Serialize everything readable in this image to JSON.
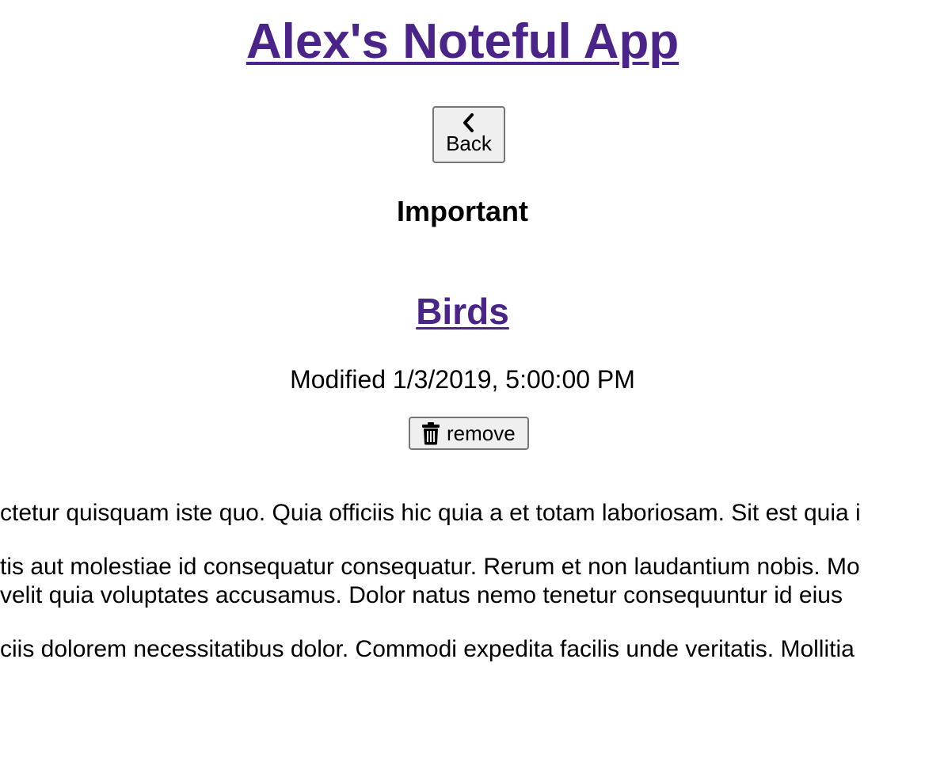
{
  "app": {
    "title": "Alex's Noteful App"
  },
  "sidebar": {
    "back_label": "Back",
    "back_icon": "chevron-left-icon",
    "folder_name": "Important"
  },
  "note": {
    "title": "Birds",
    "modified": "Modified 1/3/2019, 5:00:00 PM",
    "remove_label": "remove",
    "remove_icon": "trash-icon",
    "content_lines": [
      "ctetur quisquam iste quo. Quia officiis hic quia a et totam laboriosam. Sit est quia i",
      "tis aut molestiae id consequatur consequatur. Rerum et non laudantium nobis. Mo",
      " velit quia voluptates accusamus. Dolor natus nemo tenetur consequuntur id eius",
      "ciis dolorem necessitatibus dolor. Commodi expedita facilis unde veritatis. Mollitia"
    ]
  },
  "colors": {
    "link": "#4a2488",
    "button_bg": "#efefef",
    "button_border": "#767676"
  }
}
